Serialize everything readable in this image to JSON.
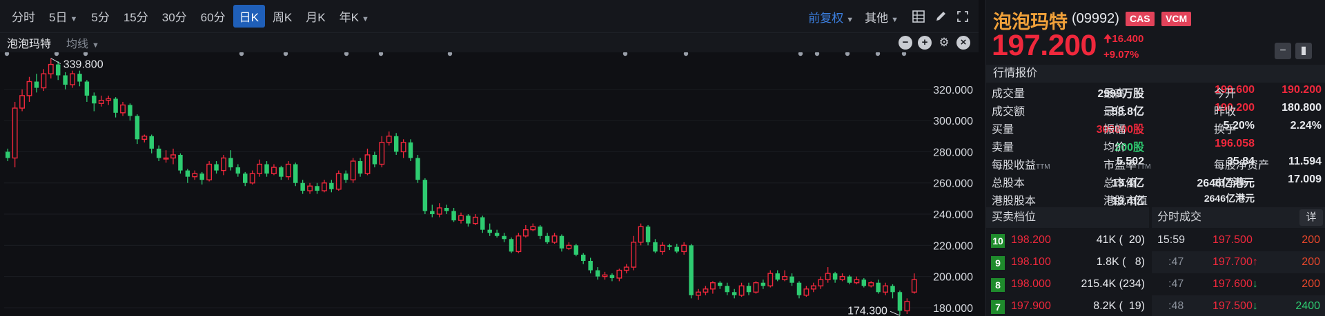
{
  "toolbar": {
    "periods": [
      "分时",
      "5日",
      "5分",
      "15分",
      "30分",
      "60分",
      "日K",
      "周K",
      "月K",
      "年K"
    ],
    "period_dropdowns": [
      false,
      true,
      false,
      false,
      false,
      false,
      false,
      false,
      false,
      true
    ],
    "active_period": "日K",
    "adjust_label": "前复权",
    "other_label": "其他",
    "icons": [
      "grid-icon",
      "pen-icon",
      "expand-icon"
    ]
  },
  "subbar": {
    "title": "泡泡玛特",
    "ma_label": "均线",
    "icons": [
      "zoom-out-icon",
      "zoom-in-icon",
      "settings-icon",
      "close-icon"
    ]
  },
  "chart_data": {
    "type": "candlestick",
    "y_ticks": [
      "320.000",
      "300.000",
      "280.000",
      "260.000",
      "240.000",
      "220.000",
      "200.000",
      "180.000"
    ],
    "ylim": [
      176,
      342
    ],
    "high_label": "339.800",
    "low_label": "174.300",
    "candles": [
      [
        280,
        276,
        282,
        274
      ],
      [
        276,
        308,
        312,
        270
      ],
      [
        308,
        316,
        320,
        306
      ],
      [
        316,
        325,
        328,
        312
      ],
      [
        325,
        321,
        330,
        318
      ],
      [
        321,
        330,
        333,
        319
      ],
      [
        330,
        336,
        340,
        327
      ],
      [
        336,
        329,
        338,
        326
      ],
      [
        329,
        323,
        331,
        320
      ],
      [
        323,
        330,
        332,
        321
      ],
      [
        330,
        325,
        332,
        322
      ],
      [
        325,
        316,
        326,
        312
      ],
      [
        316,
        311,
        318,
        306
      ],
      [
        311,
        313,
        316,
        309
      ],
      [
        313,
        314,
        316,
        310
      ],
      [
        314,
        305,
        315,
        302
      ],
      [
        305,
        310,
        312,
        303
      ],
      [
        310,
        303,
        311,
        300
      ],
      [
        303,
        288,
        304,
        285
      ],
      [
        288,
        290,
        291,
        286
      ],
      [
        290,
        282,
        291,
        279
      ],
      [
        282,
        276,
        284,
        274
      ],
      [
        276,
        276,
        281,
        273
      ],
      [
        276,
        278,
        282,
        272
      ],
      [
        278,
        268,
        279,
        266
      ],
      [
        268,
        264,
        269,
        260
      ],
      [
        264,
        266,
        268,
        262
      ],
      [
        266,
        262,
        267,
        259
      ],
      [
        262,
        272,
        274,
        261
      ],
      [
        272,
        268,
        274,
        266
      ],
      [
        268,
        276,
        278,
        265
      ],
      [
        276,
        270,
        281,
        268
      ],
      [
        270,
        266,
        272,
        264
      ],
      [
        266,
        260,
        267,
        258
      ],
      [
        260,
        266,
        268,
        259
      ],
      [
        266,
        272,
        275,
        264
      ],
      [
        272,
        266,
        274,
        264
      ],
      [
        266,
        270,
        272,
        265
      ],
      [
        270,
        264,
        271,
        262
      ],
      [
        264,
        272,
        274,
        262
      ],
      [
        272,
        260,
        273,
        258
      ],
      [
        260,
        255,
        262,
        253
      ],
      [
        255,
        258,
        260,
        253
      ],
      [
        258,
        255,
        260,
        253
      ],
      [
        255,
        260,
        262,
        254
      ],
      [
        260,
        256,
        262,
        254
      ],
      [
        256,
        266,
        268,
        255
      ],
      [
        266,
        262,
        268,
        260
      ],
      [
        262,
        274,
        276,
        260
      ],
      [
        274,
        266,
        276,
        264
      ],
      [
        266,
        278,
        282,
        265
      ],
      [
        278,
        272,
        280,
        270
      ],
      [
        272,
        286,
        290,
        270
      ],
      [
        286,
        290,
        293,
        284
      ],
      [
        290,
        280,
        292,
        278
      ],
      [
        280,
        286,
        288,
        276
      ],
      [
        286,
        276,
        288,
        274
      ],
      [
        276,
        262,
        278,
        260
      ],
      [
        262,
        242,
        263,
        240
      ],
      [
        242,
        240,
        246,
        238
      ],
      [
        240,
        244,
        247,
        238
      ],
      [
        244,
        242,
        246,
        240
      ],
      [
        242,
        236,
        244,
        235
      ],
      [
        236,
        239,
        241,
        234
      ],
      [
        239,
        234,
        240,
        232
      ],
      [
        234,
        238,
        240,
        233
      ],
      [
        238,
        230,
        239,
        228
      ],
      [
        230,
        228,
        234,
        226
      ],
      [
        228,
        226,
        230,
        225
      ],
      [
        226,
        224,
        228,
        222
      ],
      [
        224,
        216,
        225,
        215
      ],
      [
        216,
        226,
        228,
        215
      ],
      [
        226,
        230,
        233,
        225
      ],
      [
        230,
        232,
        234,
        229
      ],
      [
        232,
        226,
        233,
        224
      ],
      [
        226,
        222,
        228,
        221
      ],
      [
        222,
        226,
        228,
        221
      ],
      [
        226,
        218,
        227,
        216
      ],
      [
        218,
        220,
        222,
        217
      ],
      [
        220,
        214,
        221,
        213
      ],
      [
        214,
        210,
        215,
        208
      ],
      [
        210,
        204,
        212,
        202
      ],
      [
        204,
        200,
        206,
        198
      ],
      [
        200,
        201,
        203,
        198
      ],
      [
        201,
        199,
        202,
        197
      ],
      [
        199,
        204,
        205,
        197
      ],
      [
        204,
        206,
        208,
        202
      ],
      [
        206,
        222,
        226,
        204
      ],
      [
        222,
        232,
        234,
        220
      ],
      [
        232,
        222,
        233,
        220
      ],
      [
        222,
        216,
        224,
        215
      ],
      [
        216,
        220,
        222,
        214
      ],
      [
        220,
        219,
        221,
        217
      ],
      [
        219,
        216,
        221,
        215
      ],
      [
        216,
        220,
        222,
        214
      ],
      [
        220,
        188,
        221,
        186
      ],
      [
        188,
        190,
        192,
        185
      ],
      [
        190,
        192,
        194,
        188
      ],
      [
        192,
        196,
        197,
        189
      ],
      [
        196,
        194,
        197,
        192
      ],
      [
        194,
        190,
        196,
        188
      ],
      [
        190,
        188,
        192,
        186
      ],
      [
        188,
        194,
        196,
        187
      ],
      [
        194,
        190,
        196,
        188
      ],
      [
        190,
        196,
        197,
        189
      ],
      [
        196,
        194,
        198,
        192
      ],
      [
        194,
        202,
        204,
        193
      ],
      [
        202,
        198,
        204,
        197
      ],
      [
        198,
        200,
        204,
        197
      ],
      [
        200,
        196,
        202,
        194
      ],
      [
        196,
        188,
        197,
        186
      ],
      [
        188,
        192,
        194,
        187
      ],
      [
        192,
        194,
        196,
        190
      ],
      [
        194,
        198,
        200,
        192
      ],
      [
        198,
        202,
        206,
        196
      ],
      [
        202,
        198,
        203,
        196
      ],
      [
        198,
        200,
        202,
        197
      ],
      [
        200,
        196,
        201,
        195
      ],
      [
        196,
        198,
        200,
        195
      ],
      [
        198,
        194,
        199,
        193
      ],
      [
        194,
        196,
        197,
        193
      ],
      [
        196,
        190,
        198,
        189
      ],
      [
        190,
        194,
        196,
        188
      ],
      [
        194,
        190,
        195,
        186
      ],
      [
        190,
        178,
        191,
        175
      ],
      [
        178,
        184,
        186,
        176
      ],
      [
        190,
        198,
        202,
        189
      ]
    ]
  },
  "stock": {
    "name": "泡泡玛特",
    "code": "(09992)",
    "badge1": "CAS",
    "badge2": "VCM",
    "price": "197.200",
    "change": "16.400",
    "change_pct": "+9.07%"
  },
  "quote": {
    "section_title": "行情报价",
    "volume_label": "成交量",
    "volume": "2999万股",
    "high_label": "最高",
    "high": "199.600",
    "open_label": "今开",
    "open": "190.200",
    "turnover_label": "成交额",
    "turnover": "58.8亿",
    "low_label": "最低",
    "low": "190.200",
    "prev_close_label": "昨收",
    "prev_close": "180.800",
    "bid_label": "买量",
    "bid": "308800股",
    "amplitude_label": "振幅",
    "amplitude": "5.20%",
    "turnover_rate_label": "换手",
    "turnover_rate": "2.24%",
    "ask_label": "卖量",
    "ask": "200股",
    "avg_label": "均价",
    "avg": "196.058",
    "eps_label": "每股收益",
    "eps": "5.502",
    "pe_label": "市盈率",
    "pe": "35.84",
    "bvps_label": "每股净资产",
    "bvps": "11.594",
    "total_shares_label": "总股本",
    "total_shares": "13.4亿",
    "mkt_cap_label": "总市值",
    "mkt_cap": "2646亿港元",
    "pb_label": "市净率",
    "pb": "17.009",
    "hk_shares_label": "港股股本",
    "hk_shares": "13.4亿",
    "hk_mkt_cap_label": "港股市值",
    "hk_mkt_cap": "2646亿港元",
    "ttm": "TTM"
  },
  "book": {
    "title": "买卖档位",
    "rows": [
      {
        "level": "10",
        "price": "198.200",
        "volume": "41K (  20)"
      },
      {
        "level": "9",
        "price": "198.100",
        "volume": "1.8K (   8)"
      },
      {
        "level": "8",
        "price": "198.000",
        "volume": "215.4K (234)"
      },
      {
        "level": "7",
        "price": "197.900",
        "volume": "8.2K (  19)"
      }
    ]
  },
  "trades": {
    "title": "分时成交",
    "detail_label": "详",
    "rows": [
      {
        "time": "15:59",
        "price": "197.500",
        "arrow": "",
        "volume": "200"
      },
      {
        "time": ":47",
        "price": "197.700",
        "arrow": "↑",
        "volume": "200"
      },
      {
        "time": ":47",
        "price": "197.600",
        "arrow": "↓",
        "volume": "200"
      },
      {
        "time": ":48",
        "price": "197.500",
        "arrow": "↓",
        "volume": "2400"
      }
    ]
  },
  "colors": {
    "up": "#f0283c",
    "down": "#2ecc71",
    "accent": "#f0a13a",
    "active_tab": "#1f5fb8"
  }
}
